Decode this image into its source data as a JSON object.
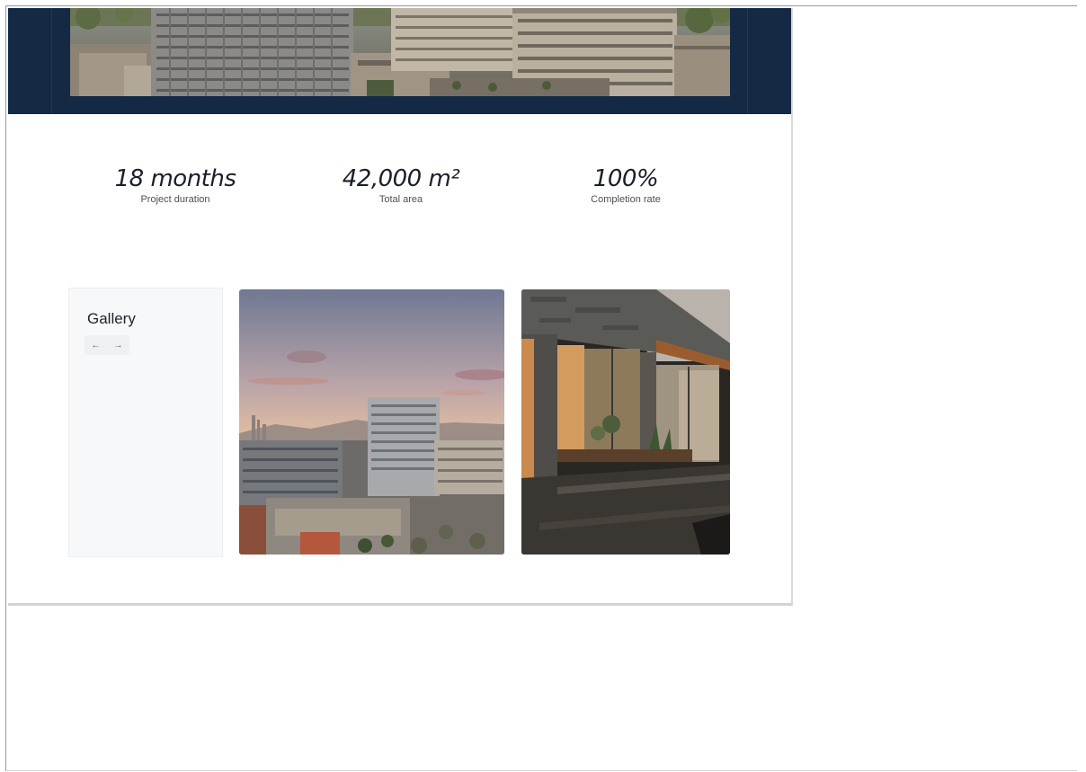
{
  "stats": [
    {
      "value": "18 months",
      "label": "Project duration"
    },
    {
      "value": "42,000 m²",
      "label": "Total area"
    },
    {
      "value": "100%",
      "label": "Completion rate"
    }
  ],
  "gallery": {
    "title": "Gallery",
    "prev_icon": "←",
    "next_icon": "→"
  },
  "colors": {
    "hero_background": "#142a44",
    "gallery_card_background": "#f7f8f9",
    "stat_text": "#1a1f2b"
  }
}
